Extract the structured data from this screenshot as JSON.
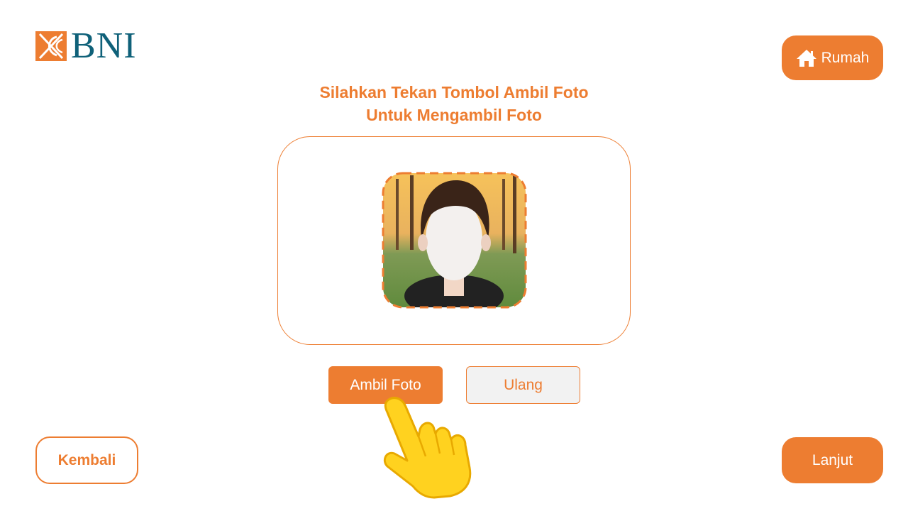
{
  "brand": {
    "name": "BNI",
    "color": "#0f6179",
    "accent": "#ed7d31"
  },
  "header": {
    "home_label": "Rumah",
    "home_icon": "home-icon"
  },
  "instruction": {
    "line1": "Silahkan Tekan Tombol Ambil Foto",
    "line2": "Untuk Mengambil Foto"
  },
  "camera": {
    "subject": "photo-preview"
  },
  "actions": {
    "capture_label": "Ambil Foto",
    "retry_label": "Ulang"
  },
  "footer": {
    "back_label": "Kembali",
    "next_label": "Lanjut"
  },
  "hint": {
    "icon": "pointing-hand-icon"
  }
}
